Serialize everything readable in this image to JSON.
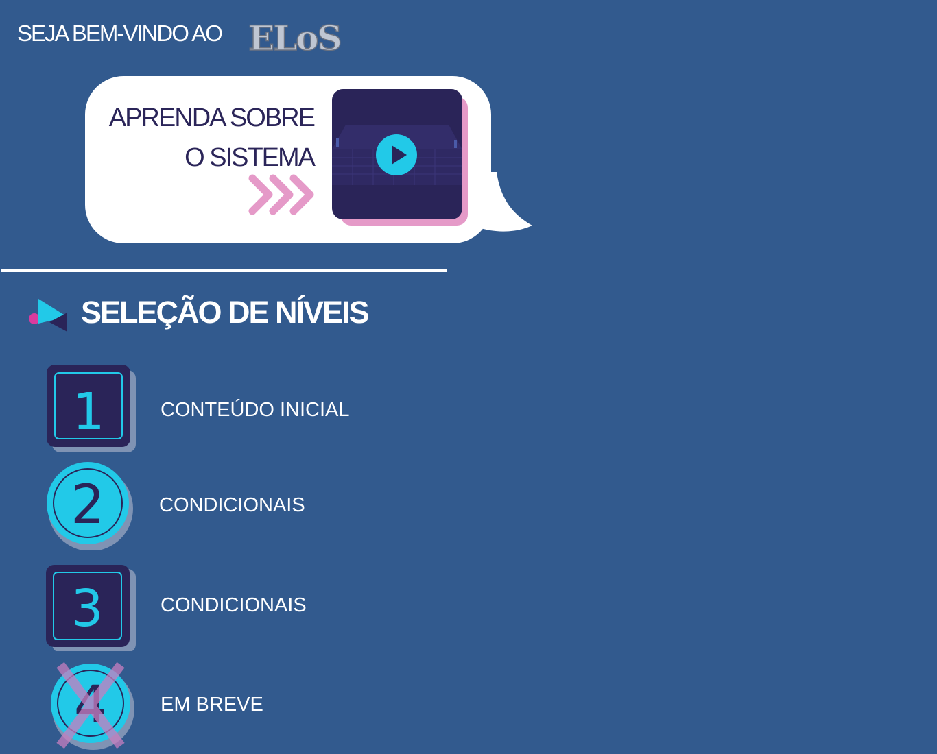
{
  "header": {
    "welcome_text": "SEJA BEM-VINDO AO",
    "logo_text": "ELoS"
  },
  "intro_card": {
    "line1": "APRENDA SOBRE",
    "line2": "O SISTEMA",
    "video_action": "play-icon"
  },
  "levels_section": {
    "title": "SELEÇÃO DE NÍVEIS",
    "levels": [
      {
        "number": "1",
        "label": "CONTEÚDO INICIAL",
        "shape": "square",
        "status": "available"
      },
      {
        "number": "2",
        "label": "CONDICIONAIS",
        "shape": "circle",
        "status": "available"
      },
      {
        "number": "3",
        "label": "CONDICIONAIS",
        "shape": "square",
        "status": "available"
      },
      {
        "number": "4",
        "label": "EM BREVE",
        "shape": "circle",
        "status": "locked"
      }
    ]
  },
  "colors": {
    "background": "#325a8e",
    "navy": "#2a2458",
    "cyan": "#22c9e8",
    "pink": "#e59ac8",
    "magenta": "#d93b9e",
    "white": "#ffffff"
  }
}
